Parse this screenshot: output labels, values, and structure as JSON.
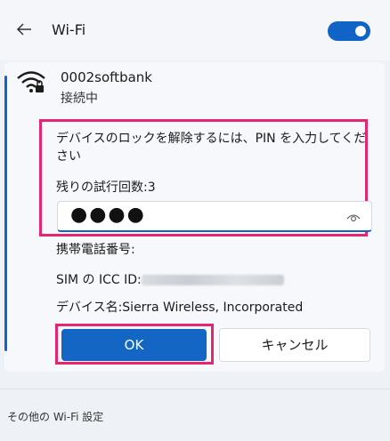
{
  "header": {
    "title": "Wi-Fi",
    "wifi_toggle_on": true,
    "accent_color": "#0f64c6"
  },
  "network": {
    "name": "0002softbank",
    "status": "接続中"
  },
  "pin_prompt": {
    "message": "デバイスのロックを解除するには、PIN を入力してください",
    "attempts_label": "残りの試行回数:3",
    "pin_masked": "●●●●"
  },
  "device_info": {
    "phone_label": "携帯電話番号:",
    "sim_label": "SIM の ICC ID:",
    "device_name_label": "デバイス名:Sierra Wireless, Incorporated"
  },
  "buttons": {
    "ok": "OK",
    "cancel": "キャンセル"
  },
  "footer": {
    "link": "その他の Wi-Fi 設定"
  },
  "highlight_color": "#e5256f"
}
